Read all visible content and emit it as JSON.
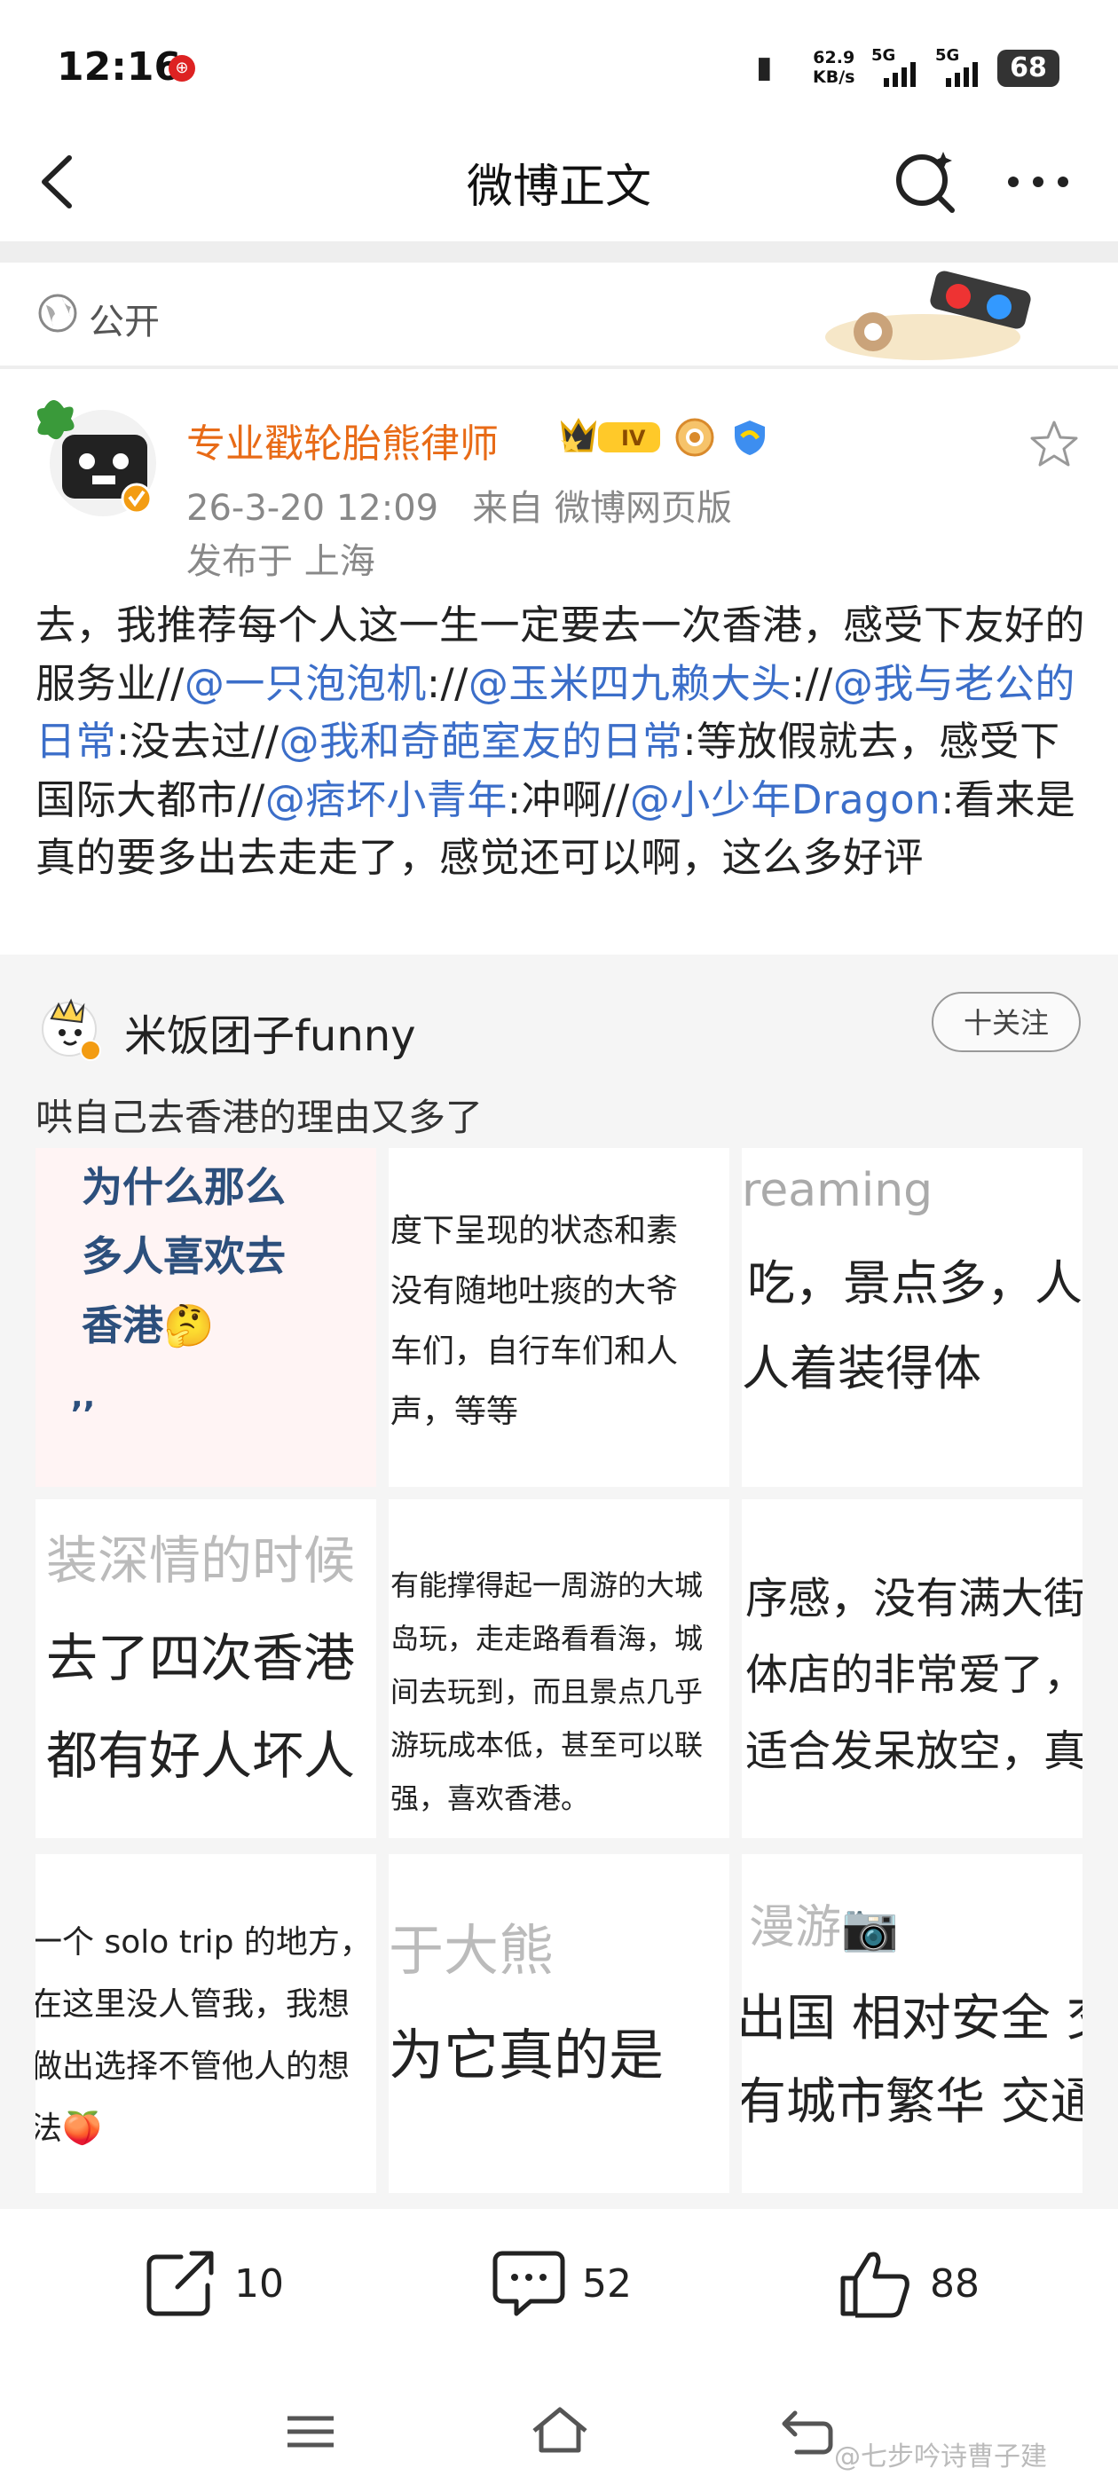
{
  "status_bar": {
    "time": "12:16",
    "network_speed_value": "62.9",
    "network_speed_unit": "KB/s",
    "sim1": "5G",
    "sim2": "5G",
    "battery": "68"
  },
  "nav": {
    "title": "微博正文"
  },
  "visibility": {
    "label": "公开"
  },
  "post": {
    "author": "专业戳轮胎熊律师",
    "level": "IV",
    "meta": "26-3-20 12:09   来自 微博网页版",
    "location": "发布于 上海",
    "body_segments": [
      {
        "text": "去，我推荐每个人这一生一定要去一次香港，感受下友好的服务业//",
        "mention": false
      },
      {
        "text": "@一只泡泡机",
        "mention": true
      },
      {
        "text": "://",
        "mention": false
      },
      {
        "text": "@玉米四九赖大头",
        "mention": true
      },
      {
        "text": "://",
        "mention": false
      },
      {
        "text": "@我与老公的日常",
        "mention": true
      },
      {
        "text": ":没去过//",
        "mention": false
      },
      {
        "text": "@我和奇葩室友的日常",
        "mention": true
      },
      {
        "text": ":等放假就去，感受下国际大都市//",
        "mention": false
      },
      {
        "text": "@痞坏小青年",
        "mention": true
      },
      {
        "text": ":冲啊//",
        "mention": false
      },
      {
        "text": "@小少年Dragon",
        "mention": true
      },
      {
        "text": ":看来是真的要多出去走走了，感觉还可以啊，这么多好评",
        "mention": false
      }
    ]
  },
  "repost": {
    "author": "米饭团子funny",
    "follow_label": "十关注",
    "text": "哄自己去香港的理由又多了",
    "tiles": [
      {
        "lines": [
          "为什么那么",
          "多人喜欢去",
          "香港🤔",
          ",,"
        ]
      },
      {
        "lines": [
          "度下呈现的状态和素",
          "没有随地吐痰的大爷",
          "车们，自行车们和人",
          "声，等等"
        ]
      },
      {
        "lines": [
          "reaming",
          "吃，景点多，人",
          "人着装得体"
        ]
      },
      {
        "lines": [
          "装深情的时候",
          "去了四次香港",
          "都有好人坏人"
        ]
      },
      {
        "lines": [
          "有能撑得起一周游的大城",
          "岛玩，走走路看看海，城",
          "间去玩到，而且景点几乎",
          "游玩成本低，甚至可以联",
          "强，喜欢香港。"
        ]
      },
      {
        "lines": [
          "序感，没有满大街",
          "体店的非常爱了，",
          "适合发呆放空，真"
        ]
      },
      {
        "lines": [
          "一个 solo trip 的地方，",
          "在这里没人管我，我想",
          "做出选择不管他人的想",
          "法🍑"
        ]
      },
      {
        "lines": [
          "于大熊",
          "为它真的是"
        ]
      },
      {
        "lines": [
          "漫游📷",
          "出国 相对安全 交",
          "有城市繁华 交通"
        ]
      }
    ]
  },
  "actions": {
    "repost_count": "10",
    "comment_count": "52",
    "like_count": "88"
  },
  "watermark": "@七步吟诗曹子建"
}
